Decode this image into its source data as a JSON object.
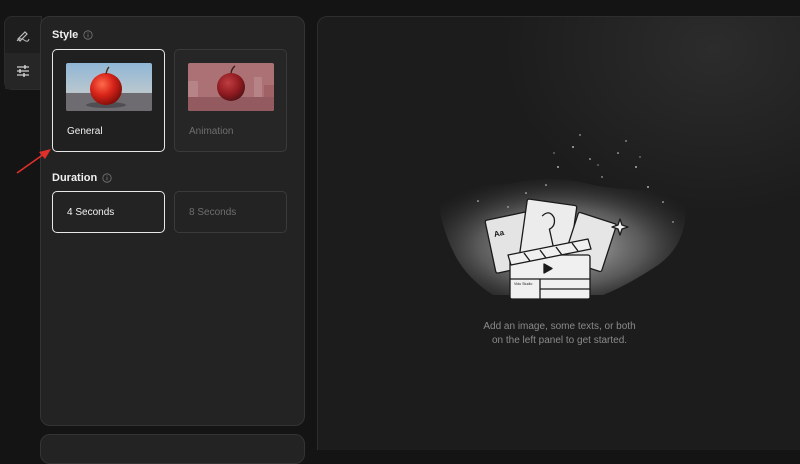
{
  "rail": {
    "items": [
      {
        "icon": "pen-icon"
      },
      {
        "icon": "sliders-icon"
      }
    ]
  },
  "style_section": {
    "title": "Style",
    "options": [
      {
        "label": "General",
        "selected": true
      },
      {
        "label": "Animation",
        "selected": false
      }
    ]
  },
  "duration_section": {
    "title": "Duration",
    "options": [
      {
        "label": "4 Seconds",
        "selected": true
      },
      {
        "label": "8 Seconds",
        "selected": false
      }
    ]
  },
  "canvas": {
    "illustration_text": "Vidu Studio",
    "empty_line1": "Add an image, some texts, or both",
    "empty_line2": "on the left panel to get started."
  },
  "colors": {
    "annotation_arrow": "#e0302b",
    "selected_border": "#e8e8e8"
  }
}
